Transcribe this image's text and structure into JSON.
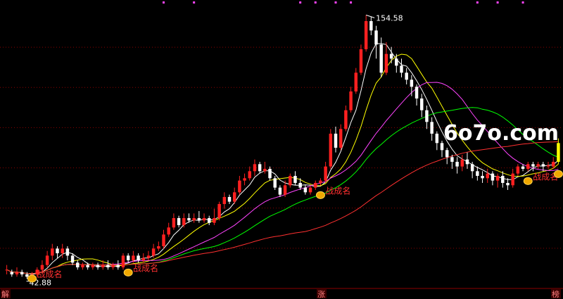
{
  "watermark": "6o7o.com",
  "chart_data": {
    "type": "candlestick",
    "annotations": {
      "high_label": "154.58",
      "low_label": "42.88",
      "signal_label": "战成名",
      "bottom_markers": [
        "解",
        "涨",
        "榜"
      ]
    },
    "candles": [
      [
        1,
        46,
        46,
        44,
        48
      ],
      [
        2,
        45,
        44,
        43,
        46
      ],
      [
        3,
        44,
        45,
        43,
        47
      ],
      [
        4,
        45,
        44,
        43,
        46
      ],
      [
        5,
        44,
        43,
        42,
        45
      ],
      [
        6,
        43,
        44,
        42.88,
        45
      ],
      [
        7,
        44,
        46,
        43,
        47
      ],
      [
        8,
        46,
        48,
        45,
        50
      ],
      [
        9,
        48,
        52,
        47,
        54
      ],
      [
        10,
        52,
        55,
        50,
        57
      ],
      [
        11,
        55,
        53,
        51,
        56
      ],
      [
        12,
        53,
        55,
        51,
        57
      ],
      [
        13,
        55,
        52,
        50,
        56
      ],
      [
        14,
        52,
        49,
        48,
        53
      ],
      [
        15,
        49,
        47,
        46,
        50
      ],
      [
        16,
        47,
        48,
        46,
        49
      ],
      [
        17,
        48,
        47,
        46,
        49
      ],
      [
        18,
        47,
        48,
        46,
        49
      ],
      [
        19,
        48,
        47,
        46,
        49
      ],
      [
        20,
        47,
        48,
        46,
        50
      ],
      [
        21,
        48,
        47,
        46,
        50
      ],
      [
        22,
        47,
        48,
        46,
        49
      ],
      [
        23,
        48,
        47,
        46,
        50
      ],
      [
        24,
        47,
        52,
        46,
        53
      ],
      [
        25,
        52,
        50,
        49,
        53
      ],
      [
        26,
        50,
        52,
        49,
        54
      ],
      [
        27,
        52,
        50,
        49,
        53
      ],
      [
        28,
        50,
        51,
        49,
        53
      ],
      [
        29,
        51,
        52,
        50,
        54
      ],
      [
        30,
        52,
        55,
        51,
        57
      ],
      [
        31,
        55,
        56,
        54,
        58
      ],
      [
        32,
        56,
        61,
        55,
        63
      ],
      [
        33,
        61,
        64,
        60,
        66
      ],
      [
        34,
        64,
        68,
        63,
        70
      ],
      [
        35,
        68,
        65,
        64,
        69
      ],
      [
        36,
        65,
        68,
        64,
        70
      ],
      [
        37,
        68,
        67,
        66,
        70
      ],
      [
        38,
        67,
        68,
        66,
        70
      ],
      [
        39,
        68,
        67,
        66,
        71
      ],
      [
        40,
        67,
        68,
        66,
        70
      ],
      [
        41,
        68,
        66,
        65,
        69
      ],
      [
        42,
        66,
        68,
        65,
        72
      ],
      [
        43,
        68,
        74,
        67,
        75
      ],
      [
        44,
        74,
        77,
        72,
        79
      ],
      [
        45,
        77,
        75,
        74,
        78
      ],
      [
        46,
        75,
        79,
        74,
        81
      ],
      [
        47,
        79,
        84,
        78,
        86
      ],
      [
        48,
        84,
        85,
        82,
        87
      ],
      [
        49,
        85,
        88,
        84,
        90
      ],
      [
        50,
        88,
        91,
        86,
        93
      ],
      [
        51,
        91,
        88,
        87,
        92
      ],
      [
        52,
        88,
        89,
        87,
        92
      ],
      [
        53,
        89,
        85,
        84,
        90
      ],
      [
        54,
        85,
        81,
        80,
        86
      ],
      [
        55,
        81,
        78,
        77,
        82
      ],
      [
        56,
        78,
        82,
        77,
        84
      ],
      [
        57,
        82,
        86,
        81,
        87
      ],
      [
        58,
        86,
        83,
        82,
        88
      ],
      [
        59,
        83,
        81,
        80,
        85
      ],
      [
        60,
        81,
        79,
        78,
        82
      ],
      [
        61,
        79,
        81,
        78,
        82
      ],
      [
        62,
        81,
        83,
        80,
        84
      ],
      [
        63,
        83,
        84,
        82,
        85
      ],
      [
        64,
        84,
        90,
        83,
        92
      ],
      [
        65,
        90,
        104,
        89,
        106
      ],
      [
        66,
        104,
        98,
        96,
        107
      ],
      [
        67,
        98,
        106,
        97,
        108
      ],
      [
        68,
        106,
        114,
        105,
        116
      ],
      [
        69,
        114,
        122,
        113,
        124
      ],
      [
        70,
        122,
        130,
        121,
        132
      ],
      [
        71,
        130,
        140,
        129,
        142
      ],
      [
        72,
        140,
        152,
        139,
        154.58
      ],
      [
        73,
        152,
        148,
        146,
        154
      ],
      [
        74,
        148,
        142,
        136,
        150
      ],
      [
        75,
        142,
        130,
        128,
        145
      ],
      [
        76,
        130,
        138,
        129,
        143
      ],
      [
        77,
        138,
        136,
        134,
        141
      ],
      [
        78,
        136,
        133,
        130,
        138
      ],
      [
        79,
        133,
        130,
        128,
        136
      ],
      [
        80,
        130,
        127,
        125,
        132
      ],
      [
        81,
        127,
        124,
        120,
        129
      ],
      [
        82,
        124,
        119,
        116,
        125
      ],
      [
        83,
        119,
        114,
        111,
        121
      ],
      [
        84,
        114,
        109,
        106,
        116
      ],
      [
        85,
        109,
        104,
        101,
        111
      ],
      [
        86,
        104,
        100,
        97,
        105
      ],
      [
        87,
        100,
        97,
        94,
        101
      ],
      [
        88,
        97,
        94,
        91,
        98
      ],
      [
        89,
        94,
        92,
        89,
        95
      ],
      [
        90,
        92,
        90,
        87,
        94
      ],
      [
        91,
        90,
        93,
        88,
        95
      ],
      [
        92,
        93,
        91,
        89,
        96
      ],
      [
        93,
        91,
        88,
        85,
        92
      ],
      [
        94,
        88,
        86,
        84,
        90
      ],
      [
        95,
        86,
        85,
        83,
        88
      ],
      [
        96,
        85,
        87,
        83,
        89
      ],
      [
        97,
        87,
        84,
        82,
        88
      ],
      [
        98,
        84,
        86,
        81,
        87
      ],
      [
        99,
        86,
        83,
        81,
        88
      ],
      [
        100,
        83,
        82,
        80,
        85
      ],
      [
        101,
        82,
        87,
        81,
        89
      ],
      [
        102,
        87,
        90,
        86,
        91
      ],
      [
        103,
        90,
        89,
        88,
        91
      ],
      [
        104,
        89,
        91,
        88,
        92
      ],
      [
        105,
        91,
        90,
        88,
        92
      ],
      [
        106,
        90,
        91,
        89,
        92
      ],
      [
        107,
        91,
        90,
        88,
        92
      ],
      [
        108,
        90,
        90.5,
        89,
        92
      ],
      [
        109,
        90,
        92,
        89,
        94
      ],
      [
        110,
        92,
        100,
        91,
        102
      ]
    ],
    "ma_periods": [
      5,
      10,
      20,
      30,
      60
    ],
    "ma_colors": [
      "#ffffff",
      "#ffff00",
      "#ff44ff",
      "#00ff00",
      "#ff3030"
    ],
    "signal_points": [
      6,
      25,
      63,
      104,
      110
    ],
    "top_dots": [
      32,
      38,
      59,
      62,
      66,
      69,
      94,
      98,
      103
    ],
    "price_range": [
      38,
      158
    ]
  },
  "colors": {
    "up": "#ff2020",
    "down": "#ffffff",
    "grid": "#8b0000",
    "label": "#ff3030",
    "marker_bg": "#3a0000"
  }
}
